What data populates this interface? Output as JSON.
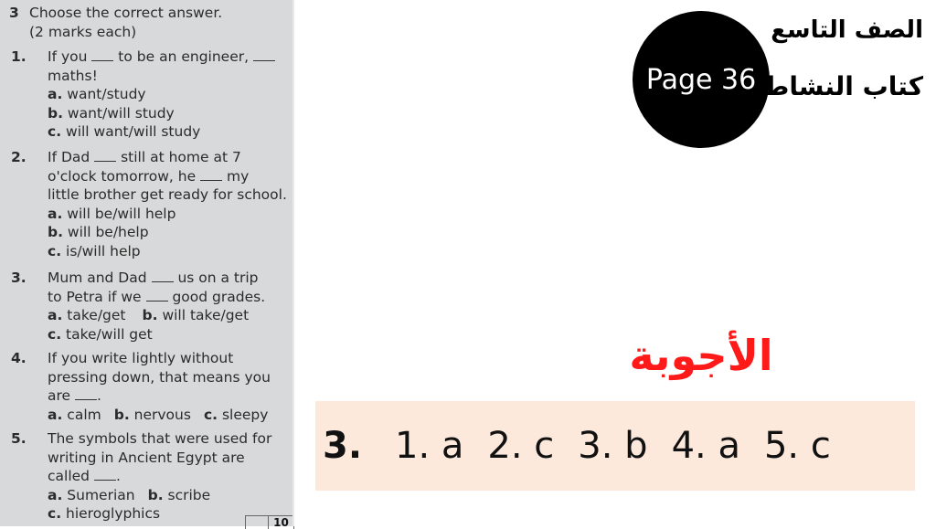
{
  "exercise": {
    "number": "3",
    "title": "Choose the correct answer.",
    "subtitle": "(2 marks each)",
    "questions": [
      {
        "num": "1.",
        "lines": [
          "If you ___ to be an engineer, ___",
          "maths!"
        ],
        "options": [
          {
            "letter": "a.",
            "text": "want/study"
          },
          {
            "letter": "b.",
            "text": "want/will study"
          },
          {
            "letter": "c.",
            "text": "will want/will study"
          }
        ]
      },
      {
        "num": "2.",
        "lines": [
          "If Dad ___ still at home at 7",
          "o'clock tomorrow, he ___ my",
          "little brother get ready for school."
        ],
        "options": [
          {
            "letter": "a.",
            "text": "will be/will help"
          },
          {
            "letter": "b.",
            "text": "will be/help"
          },
          {
            "letter": "c.",
            "text": "is/will help"
          }
        ]
      },
      {
        "num": "3.",
        "lines": [
          "Mum and Dad ___ us on a trip",
          "to Petra if we ___ good grades."
        ],
        "options": [
          {
            "letter": "a.",
            "text": "take/get"
          },
          {
            "letter": "b.",
            "text": "will take/get"
          },
          {
            "letter": "c.",
            "text": "take/will get"
          }
        ]
      },
      {
        "num": "4.",
        "lines": [
          "If you write lightly without",
          "pressing down, that means you",
          "are ___."
        ],
        "options": [
          {
            "letter": "a.",
            "text": "calm"
          },
          {
            "letter": "b.",
            "text": "nervous"
          },
          {
            "letter": "c.",
            "text": "sleepy"
          }
        ]
      },
      {
        "num": "5.",
        "lines": [
          "The symbols that were used for",
          "writing in Ancient Egypt are",
          "called ___."
        ],
        "options": [
          {
            "letter": "a.",
            "text": "Sumerian"
          },
          {
            "letter": "b.",
            "text": "scribe"
          },
          {
            "letter": "c.",
            "text": "hieroglyphics"
          }
        ]
      }
    ],
    "total_marks": "10"
  },
  "header": {
    "page_badge": "Page 36",
    "grade_label": "الصف التاسع",
    "book_label": "كتاب النشاط"
  },
  "answers": {
    "title": "الأجوبة",
    "exercise": "3.",
    "items": [
      "1. a",
      "2. c",
      "3. b",
      "4. a",
      "5. c"
    ]
  },
  "colors": {
    "answers_title": "#ff1a1a",
    "answer_box_bg": "#fde9dc",
    "panel_bg": "#d8d9da",
    "badge_bg": "#000000"
  }
}
